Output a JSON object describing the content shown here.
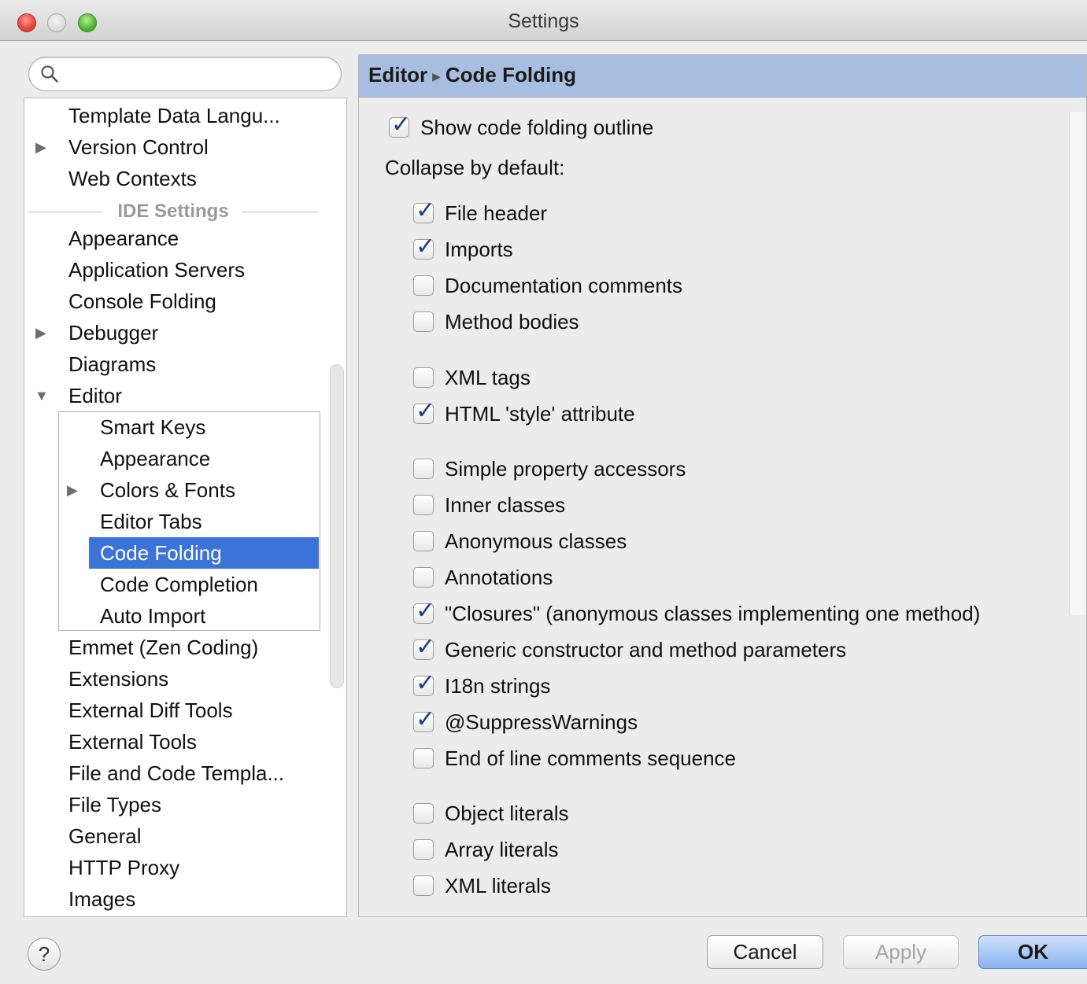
{
  "window": {
    "title": "Settings"
  },
  "search": {
    "placeholder": "",
    "value": ""
  },
  "tree": {
    "top_items": [
      {
        "label": "Template Data Langu...",
        "expandable": false
      },
      {
        "label": "Version Control",
        "expandable": true
      },
      {
        "label": "Web Contexts",
        "expandable": false
      }
    ],
    "section_label": "IDE Settings",
    "ide_items": [
      {
        "label": "Appearance",
        "expandable": false
      },
      {
        "label": "Application Servers",
        "expandable": false
      },
      {
        "label": "Console Folding",
        "expandable": false
      },
      {
        "label": "Debugger",
        "expandable": true
      },
      {
        "label": "Diagrams",
        "expandable": false
      },
      {
        "label": "Editor",
        "expandable": true,
        "expanded": true
      }
    ],
    "editor_children": [
      {
        "label": "Smart Keys",
        "expandable": false
      },
      {
        "label": "Appearance",
        "expandable": false
      },
      {
        "label": "Colors & Fonts",
        "expandable": true
      },
      {
        "label": "Editor Tabs",
        "expandable": false
      },
      {
        "label": "Code Folding",
        "expandable": false,
        "selected": true
      },
      {
        "label": "Code Completion",
        "expandable": false
      },
      {
        "label": "Auto Import",
        "expandable": false
      }
    ],
    "after_items": [
      {
        "label": "Emmet (Zen Coding)"
      },
      {
        "label": "Extensions"
      },
      {
        "label": "External Diff Tools"
      },
      {
        "label": "External Tools"
      },
      {
        "label": "File and Code Templa..."
      },
      {
        "label": "File Types"
      },
      {
        "label": "General"
      },
      {
        "label": "HTTP Proxy"
      },
      {
        "label": "Images"
      }
    ]
  },
  "content": {
    "breadcrumb": {
      "parent": "Editor",
      "current": "Code Folding"
    },
    "show_outline": {
      "label": "Show code folding outline",
      "checked": true
    },
    "collapse_label": "Collapse by default:",
    "options": [
      {
        "label": "File header",
        "checked": true
      },
      {
        "label": "Imports",
        "checked": true
      },
      {
        "label": "Documentation comments",
        "checked": false
      },
      {
        "label": "Method bodies",
        "checked": false
      },
      {
        "label": "XML tags",
        "checked": false
      },
      {
        "label": "HTML 'style' attribute",
        "checked": true
      },
      {
        "label": "Simple property accessors",
        "checked": false
      },
      {
        "label": "Inner classes",
        "checked": false
      },
      {
        "label": "Anonymous classes",
        "checked": false
      },
      {
        "label": "Annotations",
        "checked": false
      },
      {
        "label": "\"Closures\" (anonymous classes implementing one method)",
        "checked": true
      },
      {
        "label": "Generic constructor and method parameters",
        "checked": true
      },
      {
        "label": "I18n strings",
        "checked": true
      },
      {
        "label": "@SuppressWarnings",
        "checked": true
      },
      {
        "label": "End of line comments sequence",
        "checked": false
      },
      {
        "label": "Object literals",
        "checked": false
      },
      {
        "label": "Array literals",
        "checked": false
      },
      {
        "label": "XML literals",
        "checked": false
      }
    ]
  },
  "footer": {
    "help_label": "?",
    "cancel_label": "Cancel",
    "apply_label": "Apply",
    "ok_label": "OK"
  },
  "colors": {
    "selection": "#3b73d8",
    "header_bar": "#a8bee0",
    "window_bg": "#ececec"
  }
}
